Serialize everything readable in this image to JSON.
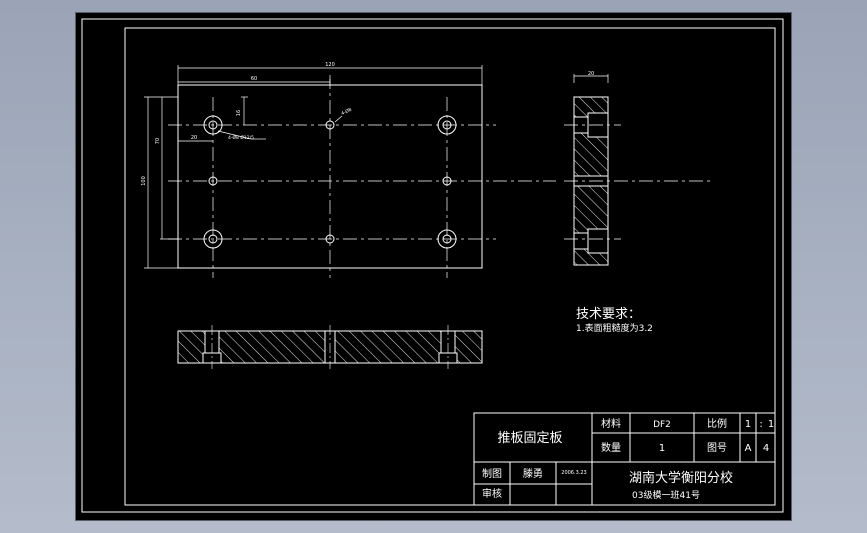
{
  "drawing": {
    "background": "#000000",
    "line_color": "#ffffff",
    "dimensions": {
      "overall_width": "120",
      "half_width": "60",
      "right_view_thickness": "20",
      "left_offset": "20",
      "top_offset": "16",
      "hole_row_spacing": "70",
      "overall_height": "100"
    },
    "callouts": {
      "counterbore": "4-Ø8 Ø12/5",
      "center_hole": "4-Ø8"
    },
    "tech_requirements": {
      "heading": "技术要求：",
      "item1": "1.表面粗糙度为3.2"
    },
    "title_block": {
      "part_name": "推板固定板",
      "material_label": "材料",
      "material_value": "DF2",
      "scale_label": "比例",
      "scale_left": "1",
      "scale_sep": ":",
      "scale_right": "1",
      "quantity_label": "数量",
      "quantity_value": "1",
      "drawing_no_label": "图号",
      "drawing_no_left": "A",
      "drawing_no_right": "4",
      "drawn_label": "制图",
      "drawn_name": "滕勇",
      "drawn_date": "2006.3.23",
      "check_label": "审核",
      "school": "湖南大学衡阳分校",
      "class_info": "03级模一班41号"
    }
  }
}
